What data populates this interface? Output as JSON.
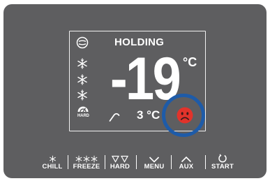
{
  "display": {
    "status_title": "HOLDING",
    "main_temperature": "-19",
    "main_unit": "°C",
    "secondary_temperature": "3 °C",
    "hard_label": "HARD",
    "status_face_color": "#e2332b",
    "highlight_ring_color": "#1e5ba8"
  },
  "buttons": [
    {
      "label": "CHILL",
      "icon": "snowflake-icon"
    },
    {
      "label": "FREEZE",
      "icon": "triple-snowflake-icon"
    },
    {
      "label": "HARD",
      "icon": "double-triangle-icon"
    },
    {
      "label": "MENU",
      "icon": "chevron-down-icon"
    },
    {
      "label": "AUX",
      "icon": "chevron-up-icon"
    },
    {
      "label": "START",
      "icon": "power-icon"
    }
  ]
}
